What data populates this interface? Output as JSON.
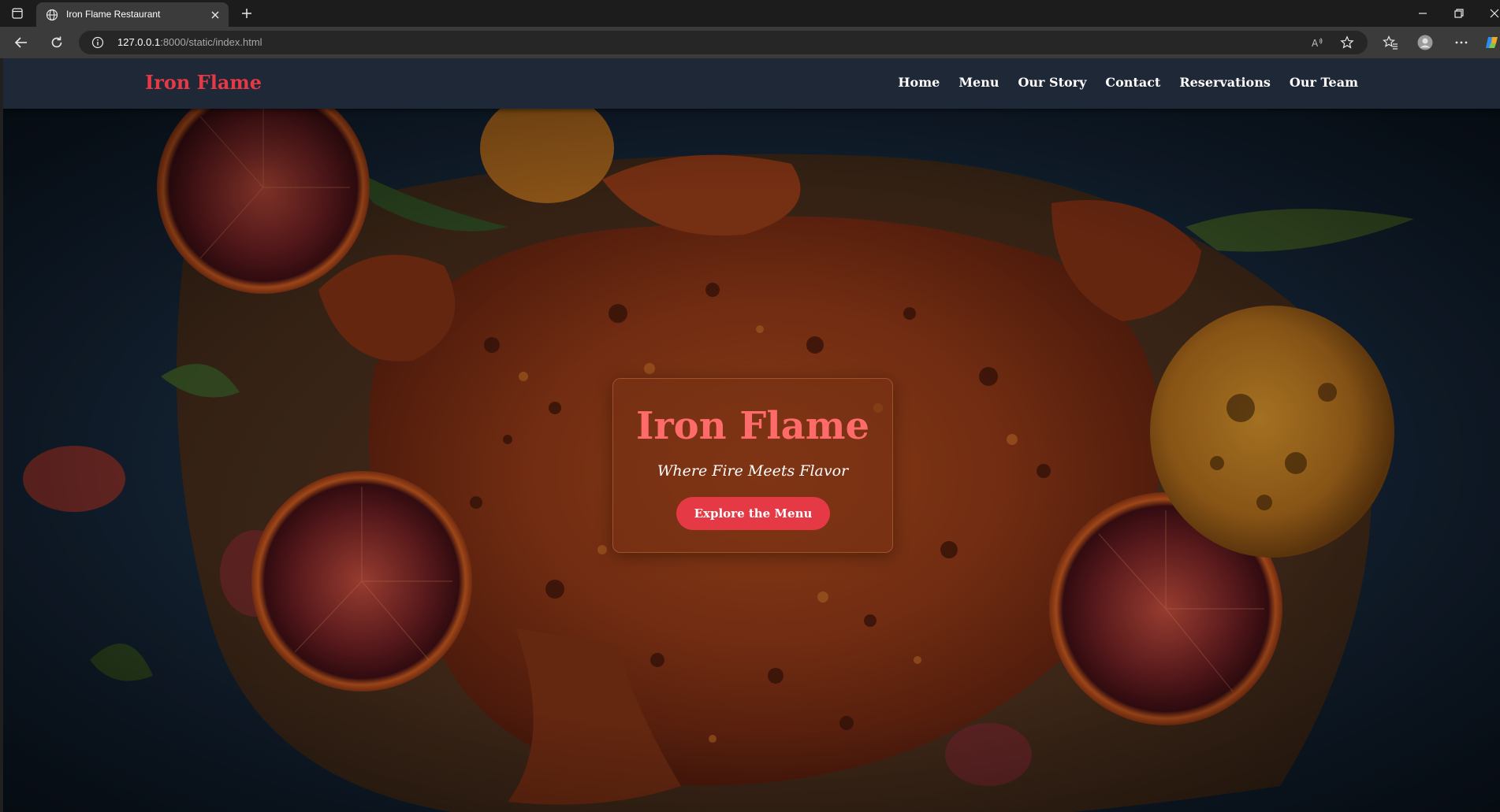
{
  "browser": {
    "tab_title": "Iron Flame Restaurant",
    "url_host": "127.0.0.1",
    "url_rest": ":8000/static/index.html"
  },
  "site": {
    "brand": "Iron Flame",
    "nav": [
      "Home",
      "Menu",
      "Our Story",
      "Contact",
      "Reservations",
      "Our Team"
    ]
  },
  "hero": {
    "title": "Iron Flame",
    "subtitle": "Where Fire Meets Flavor",
    "cta": "Explore the Menu"
  },
  "colors": {
    "accent": "#e63946",
    "hero_title": "#ff6b6b",
    "nav_bg": "#1e2836"
  }
}
